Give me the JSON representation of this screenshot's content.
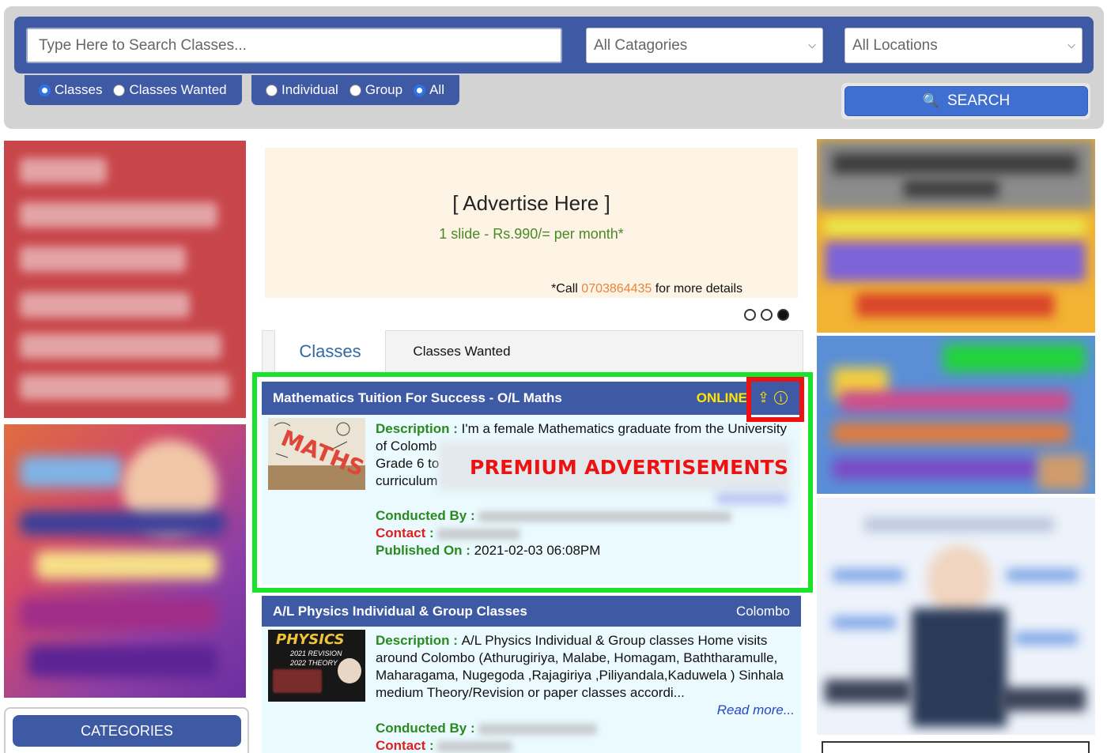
{
  "search": {
    "placeholder": "Type Here to Search Classes...",
    "category_selected": "All Catagories",
    "location_selected": "All Locations",
    "button_label": "SEARCH",
    "type_options": [
      {
        "label": "Classes",
        "checked": true
      },
      {
        "label": "Classes Wanted",
        "checked": false
      }
    ],
    "mode_options": [
      {
        "label": "Individual",
        "checked": false
      },
      {
        "label": "Group",
        "checked": false
      },
      {
        "label": "All",
        "checked": true
      }
    ]
  },
  "advert": {
    "title": "[ Advertise Here ]",
    "price": "1 slide - Rs.990/= per month*",
    "call_prefix": "*Call ",
    "call_phone": "0703864435",
    "call_suffix": " for more details",
    "slides_total": 3,
    "slide_active": 3
  },
  "tabs": [
    {
      "label": "Classes",
      "active": true
    },
    {
      "label": "Classes Wanted",
      "active": false
    }
  ],
  "listings": [
    {
      "title": "Mathematics Tuition For Success - O/L Maths",
      "badge": "ONLINE",
      "description_label": "Description",
      "description": "I'm a female Mathematics graduate from the University of Colomb",
      "description_line2": "Grade 6 to",
      "description_line3": "curriculum",
      "premium_label": "PREMIUM ADVERTISEMENTS",
      "thumb_text": "MATHS",
      "conducted_label": "Conducted By",
      "contact_label": "Contact",
      "published_label": "Published On",
      "published_value": "2021-02-03 06:08PM"
    },
    {
      "title": "A/L Physics Individual & Group Classes",
      "location": "Colombo",
      "description_label": "Description",
      "description": "A/L Physics Individual & Group classes Home visits around Colombo (Athurugiriya, Malabe, Homagam, Baththaramulle, Maharagama, Nugegoda ,Rajagiriya ,Piliyandala,Kaduwela ) Sinhala medium Theory/Revision or paper classes accordi...",
      "read_more": "Read more...",
      "thumb_title": "PHYSICS",
      "thumb_line1": "2021 REVISION",
      "thumb_line2": "2022 THEORY",
      "conducted_label": "Conducted By",
      "contact_label": "Contact"
    }
  ],
  "sidebar": {
    "categories_label": "CATEGORIES"
  },
  "colors": {
    "primary": "#3f5aa4",
    "highlight": "#19e32a",
    "alert": "#ee1111",
    "label_green": "#2a8a1e",
    "label_red": "#e02020"
  }
}
